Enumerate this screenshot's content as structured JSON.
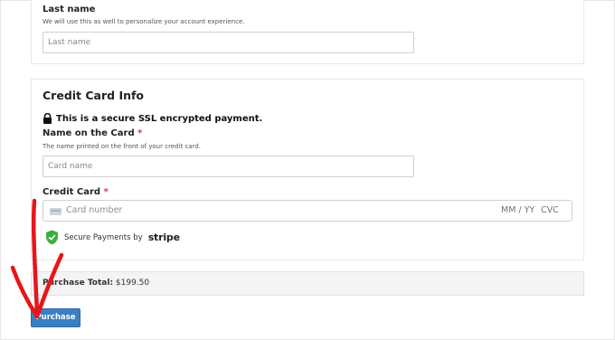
{
  "account": {
    "last_name_label": "Last name",
    "last_name_desc": "We will use this as well to personalize your account experience.",
    "last_name_placeholder": "Last name"
  },
  "credit_card_info": {
    "title": "Credit Card Info",
    "secure_notice": "This is a secure SSL encrypted payment.",
    "name_on_card_label": "Name on the Card",
    "required_mark": "*",
    "name_on_card_desc": "The name printed on the front of your credit card.",
    "card_name_placeholder": "Card name",
    "credit_card_label": "Credit Card",
    "card_number_placeholder": "Card number",
    "expiry_placeholder": "MM / YY",
    "cvc_placeholder": "CVC",
    "secure_payments_text": "Secure Payments by",
    "secure_payments_brand": "stripe"
  },
  "summary": {
    "purchase_total_label": "Purchase Total:",
    "purchase_total_value": "$199.50"
  },
  "actions": {
    "purchase_label": "Purchase"
  },
  "colors": {
    "accent": "#3a7fc2",
    "required": "#d63638",
    "shield": "#3cae3c",
    "annotation_arrow": "#e8151b"
  },
  "icons": [
    "lock-icon",
    "card-icon",
    "shield-check-icon",
    "arrow-annotation"
  ]
}
